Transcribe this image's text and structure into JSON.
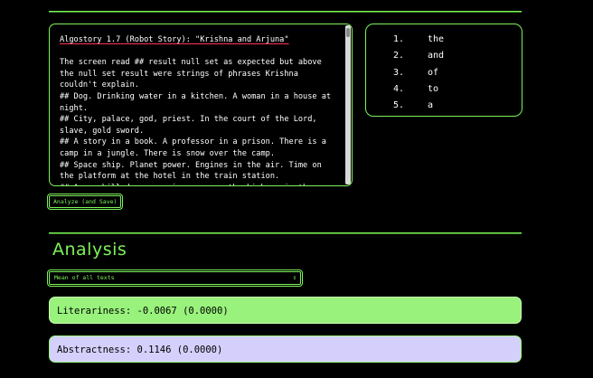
{
  "editor": {
    "title": "Algostory 1.7 (Robot Story): \"Krishna and Arjuna\"",
    "body": "\n\nThe screen read ## result null set as expected but above the null set result were strings of phrases Krishna couldn't explain.\n## Dog. Drinking water in a kitchen. A woman in a house at night.\n## City, palace, god, priest. In the court of the Lord, slave, gold sword.\n## A story in a book. A professor in a prison. There is a camp in a jungle. There is snow over the camp.\n## Space ship. Planet power. Engines in the air. Time on the platform at the hotel in the train station.\n## A man killed a woman in a car on the highway in the night"
  },
  "top_words": [
    {
      "num": "1.",
      "word": "the"
    },
    {
      "num": "2.",
      "word": "and"
    },
    {
      "num": "3.",
      "word": "of"
    },
    {
      "num": "4.",
      "word": "to"
    },
    {
      "num": "5.",
      "word": "a"
    }
  ],
  "analyze_button": "Analyze (and Save)",
  "analysis": {
    "heading": "Analysis",
    "select_value": "Mean of all texts",
    "select_arrow": "⇕",
    "literariness": "Literariness: -0.0067 (0.0000)",
    "abstractness": "Abstractness: 0.1146 (0.0000)"
  },
  "colors": {
    "accent": "#7cf25a",
    "literariness_bg": "#98f27c",
    "abstractness_bg": "#d4d0fb"
  }
}
